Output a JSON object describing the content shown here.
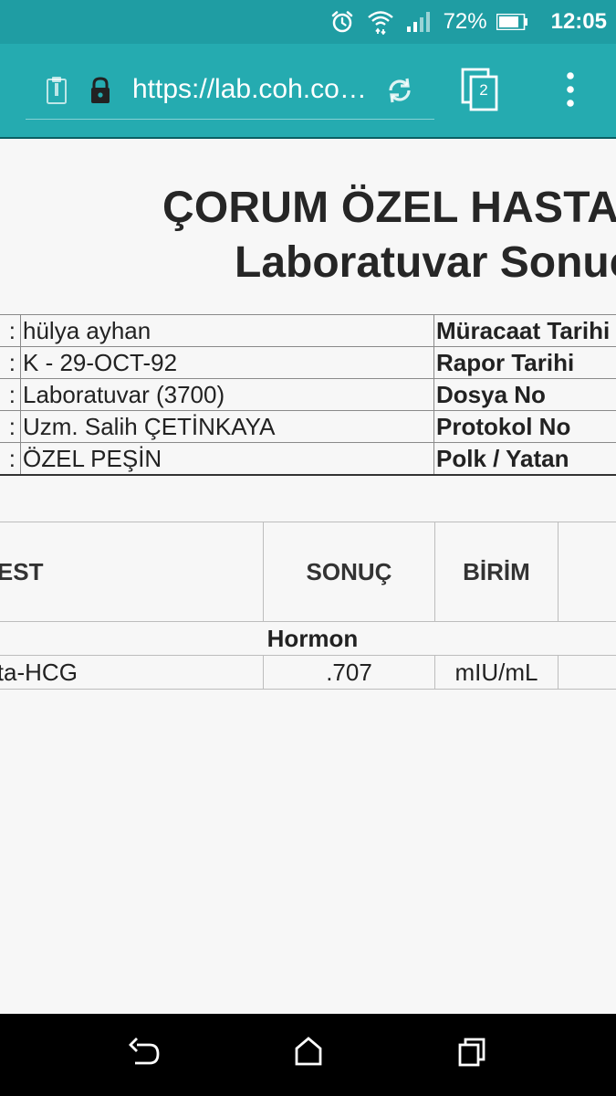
{
  "status_bar": {
    "battery_percent": "72%",
    "time": "12:05",
    "icons": [
      "alarm-icon",
      "wifi-icon",
      "signal-icon",
      "battery-icon"
    ]
  },
  "browser": {
    "url": "https://lab.coh.com.tr",
    "tab_count": "2",
    "icons": [
      "page-info-icon",
      "lock-icon",
      "reload-icon",
      "tabs-icon",
      "more-menu-icon"
    ],
    "accent_color": "#25abb0"
  },
  "report": {
    "hospital_title": "ÇORUM ÖZEL HASTANESİ",
    "report_title": "Laboratuvar Sonuç Raporu",
    "info_rows": [
      {
        "colon": ":",
        "value": "hülya ayhan",
        "label": "Müracaat Tarihi"
      },
      {
        "colon": ":",
        "value": "K - 29-OCT-92",
        "label": "Rapor Tarihi"
      },
      {
        "colon": ":",
        "value": "Laboratuvar (3700)",
        "label": "Dosya No"
      },
      {
        "colon": ":",
        "value": "Uzm. Salih ÇETİNKAYA",
        "label": "Protokol No"
      },
      {
        "colon": ":",
        "value": "ÖZEL PEŞİN",
        "label": "Polk / Yatan"
      }
    ],
    "results": {
      "headers": {
        "test": "TEST",
        "sonuc": "SONUÇ",
        "birim": "BİRİM"
      },
      "group": "Hormon",
      "rows": [
        {
          "test": "Beta-HCG",
          "sonuc": ".707",
          "birim": "mIU/mL"
        }
      ]
    }
  },
  "nav_bar": {
    "icons": [
      "back-icon",
      "home-icon",
      "recents-icon"
    ]
  }
}
